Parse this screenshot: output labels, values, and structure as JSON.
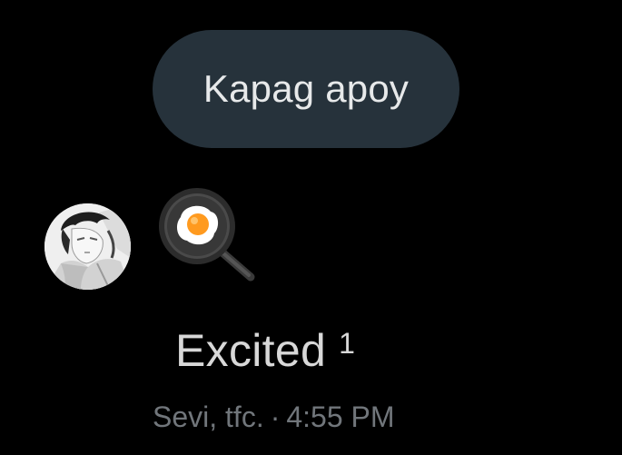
{
  "conversation": {
    "sent_message": {
      "text": "Kapag apoy"
    },
    "received_message": {
      "emoji_name": "frying-pan-with-egg",
      "emoji_icon": "cooking-icon"
    },
    "reaction": {
      "label": "Excited",
      "count": "1"
    },
    "meta": {
      "sender": "Sevi, tfc.",
      "separator": "·",
      "time": "4:55 PM"
    }
  },
  "colors": {
    "background": "#000000",
    "bubble": "#26323b",
    "bubble_text": "#e7e9ea",
    "reaction_text": "#d8d8d8",
    "meta_text": "#71767b"
  }
}
